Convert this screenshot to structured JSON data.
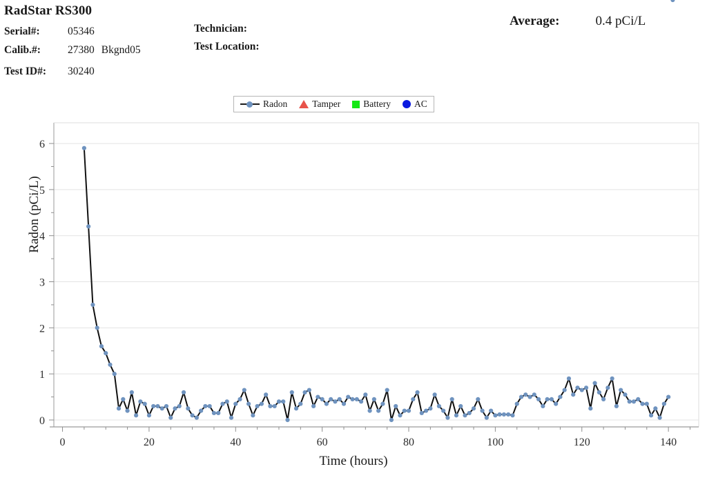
{
  "header": {
    "device_title": "RadStar RS300",
    "fields": [
      {
        "label": "Serial#:",
        "value": "05346",
        "value2": ""
      },
      {
        "label": "Calib.#:",
        "value": "27380",
        "value2": "Bkgnd05"
      },
      {
        "label": "Test ID#:",
        "value": "30240",
        "value2": ""
      }
    ],
    "technician_label": "Technician:",
    "test_location_label": "Test Location:",
    "average_label": "Average:",
    "average_value": "0.4 pCi/L"
  },
  "legend": {
    "entries": [
      {
        "label": "Radon",
        "icon": "line-circle-marker-icon",
        "color": "#6f93bf"
      },
      {
        "label": "Tamper",
        "icon": "triangle-marker-icon",
        "color": "#e8534a"
      },
      {
        "label": "Battery",
        "icon": "square-marker-icon",
        "color": "#14e814"
      },
      {
        "label": "AC",
        "icon": "circle-marker-icon",
        "color": "#0a19e0"
      }
    ]
  },
  "chart_data": {
    "type": "line",
    "title": "",
    "xlabel": "Time (hours)",
    "ylabel": "Radon (pCi/L)",
    "xlim": [
      -2,
      147
    ],
    "ylim": [
      -0.15,
      6.45
    ],
    "xticks": [
      0,
      20,
      40,
      60,
      80,
      100,
      120,
      140
    ],
    "yticks": [
      0,
      1,
      2,
      3,
      4,
      5,
      6
    ],
    "x_minor_tick_step": 5,
    "y_minor_tick_step": 0.5,
    "grid": "horizontal-major",
    "grid_color": "#e3e3e3",
    "legend_position": "top-center-outside",
    "line_color": "#101010",
    "marker_color": "#6f93bf",
    "series": [
      {
        "name": "Radon",
        "x": [
          5,
          6,
          7,
          8,
          9,
          10,
          11,
          12,
          13,
          14,
          15,
          16,
          17,
          18,
          19,
          20,
          21,
          22,
          23,
          24,
          25,
          26,
          27,
          28,
          29,
          30,
          31,
          32,
          33,
          34,
          35,
          36,
          37,
          38,
          39,
          40,
          41,
          42,
          43,
          44,
          45,
          46,
          47,
          48,
          49,
          50,
          51,
          52,
          53,
          54,
          55,
          56,
          57,
          58,
          59,
          60,
          61,
          62,
          63,
          64,
          65,
          66,
          67,
          68,
          69,
          70,
          71,
          72,
          73,
          74,
          75,
          76,
          77,
          78,
          79,
          80,
          81,
          82,
          83,
          84,
          85,
          86,
          87,
          88,
          89,
          90,
          91,
          92,
          93,
          94,
          95,
          96,
          97,
          98,
          99,
          100,
          101,
          102,
          103,
          104,
          105,
          106,
          107,
          108,
          109,
          110,
          111,
          112,
          113,
          114,
          115,
          116,
          117,
          118,
          119,
          120,
          121,
          122,
          123,
          124,
          125,
          126,
          127,
          128,
          129,
          130,
          131,
          132,
          133,
          134,
          135,
          136,
          137,
          138,
          139,
          140,
          141
        ],
        "y": [
          5.9,
          4.2,
          2.5,
          2.0,
          1.6,
          1.45,
          1.2,
          1.0,
          0.25,
          0.45,
          0.2,
          0.6,
          0.1,
          0.4,
          0.35,
          0.1,
          0.3,
          0.3,
          0.25,
          0.3,
          0.05,
          0.25,
          0.3,
          0.6,
          0.25,
          0.1,
          0.05,
          0.2,
          0.3,
          0.3,
          0.15,
          0.15,
          0.35,
          0.4,
          0.05,
          0.35,
          0.45,
          0.65,
          0.35,
          0.1,
          0.3,
          0.35,
          0.55,
          0.3,
          0.3,
          0.4,
          0.4,
          0.0,
          0.6,
          0.25,
          0.35,
          0.6,
          0.65,
          0.3,
          0.5,
          0.45,
          0.35,
          0.45,
          0.4,
          0.45,
          0.35,
          0.5,
          0.45,
          0.45,
          0.4,
          0.55,
          0.2,
          0.45,
          0.2,
          0.35,
          0.65,
          0.0,
          0.3,
          0.1,
          0.2,
          0.2,
          0.45,
          0.6,
          0.15,
          0.2,
          0.25,
          0.55,
          0.3,
          0.2,
          0.05,
          0.45,
          0.1,
          0.3,
          0.1,
          0.15,
          0.25,
          0.45,
          0.2,
          0.05,
          0.2,
          0.1,
          0.12,
          0.12,
          0.12,
          0.1,
          0.35,
          0.5,
          0.55,
          0.5,
          0.55,
          0.45,
          0.3,
          0.45,
          0.45,
          0.35,
          0.5,
          0.65,
          0.9,
          0.55,
          0.7,
          0.65,
          0.7,
          0.25,
          0.8,
          0.6,
          0.45,
          0.7,
          0.9,
          0.3,
          0.65,
          0.55,
          0.4,
          0.4,
          0.45,
          0.35,
          0.35,
          0.1,
          0.25,
          0.05,
          0.35,
          0.5
        ]
      },
      {
        "name": "Tamper",
        "x": [],
        "y": []
      },
      {
        "name": "Battery",
        "x": [],
        "y": []
      },
      {
        "name": "AC",
        "x": [],
        "y": []
      }
    ]
  }
}
